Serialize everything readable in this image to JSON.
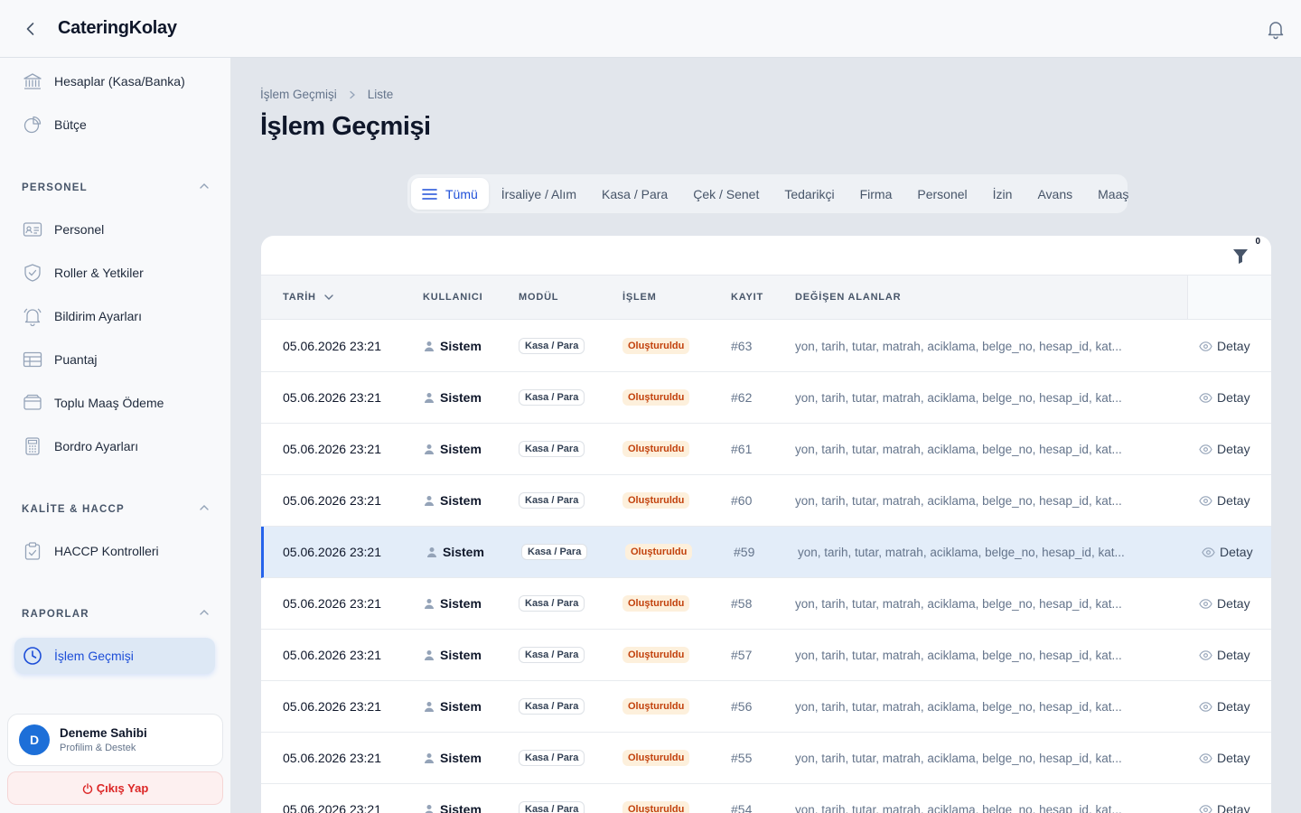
{
  "app": {
    "title": "CateringKolay"
  },
  "sidebar": {
    "top_items": [
      {
        "label": "Hesaplar (Kasa/Banka)",
        "icon": "bank-icon"
      },
      {
        "label": "Bütçe",
        "icon": "pie-chart-icon"
      }
    ],
    "sections": [
      {
        "title": "PERSONEL",
        "items": [
          "Personel",
          "Roller & Yetkiler",
          "Bildirim Ayarları",
          "Puantaj",
          "Toplu Maaş Ödeme",
          "Bordro Ayarları"
        ]
      },
      {
        "title": "KALİTE & HACCP",
        "items": [
          "HACCP Kontrolleri"
        ]
      },
      {
        "title": "RAPORLAR",
        "items": [
          "İşlem Geçmişi"
        ]
      }
    ],
    "active_item": "İşlem Geçmişi",
    "profile": {
      "initial": "D",
      "name": "Deneme Sahibi",
      "subtitle": "Profilim & Destek"
    },
    "logout_label": "Çıkış Yap"
  },
  "breadcrumb": [
    "İşlem Geçmişi",
    "Liste"
  ],
  "page_title": "İşlem Geçmişi",
  "tabs": [
    "Tümü",
    "İrsaliye / Alım",
    "Kasa / Para",
    "Çek / Senet",
    "Tedarikçi",
    "Firma",
    "Personel",
    "İzin",
    "Avans",
    "Maaş"
  ],
  "active_tab": "Tümü",
  "filter_count": "0",
  "table": {
    "headers": {
      "date": "TARİH",
      "user": "KULLANICI",
      "module": "MODÜL",
      "operation": "İŞLEM",
      "record": "KAYIT",
      "fields": "DEĞİŞEN ALANLAR"
    },
    "rows": [
      {
        "date": "05.06.2026 23:21",
        "user": "Sistem",
        "module": "Kasa / Para",
        "operation": "Oluşturuldu",
        "record": "#63",
        "fields": "yon, tarih, tutar, matrah, aciklama, belge_no, hesap_id, kat...",
        "action": "Detay"
      },
      {
        "date": "05.06.2026 23:21",
        "user": "Sistem",
        "module": "Kasa / Para",
        "operation": "Oluşturuldu",
        "record": "#62",
        "fields": "yon, tarih, tutar, matrah, aciklama, belge_no, hesap_id, kat...",
        "action": "Detay"
      },
      {
        "date": "05.06.2026 23:21",
        "user": "Sistem",
        "module": "Kasa / Para",
        "operation": "Oluşturuldu",
        "record": "#61",
        "fields": "yon, tarih, tutar, matrah, aciklama, belge_no, hesap_id, kat...",
        "action": "Detay"
      },
      {
        "date": "05.06.2026 23:21",
        "user": "Sistem",
        "module": "Kasa / Para",
        "operation": "Oluşturuldu",
        "record": "#60",
        "fields": "yon, tarih, tutar, matrah, aciklama, belge_no, hesap_id, kat...",
        "action": "Detay"
      },
      {
        "date": "05.06.2026 23:21",
        "user": "Sistem",
        "module": "Kasa / Para",
        "operation": "Oluşturuldu",
        "record": "#59",
        "fields": "yon, tarih, tutar, matrah, aciklama, belge_no, hesap_id, kat...",
        "action": "Detay"
      },
      {
        "date": "05.06.2026 23:21",
        "user": "Sistem",
        "module": "Kasa / Para",
        "operation": "Oluşturuldu",
        "record": "#58",
        "fields": "yon, tarih, tutar, matrah, aciklama, belge_no, hesap_id, kat...",
        "action": "Detay"
      },
      {
        "date": "05.06.2026 23:21",
        "user": "Sistem",
        "module": "Kasa / Para",
        "operation": "Oluşturuldu",
        "record": "#57",
        "fields": "yon, tarih, tutar, matrah, aciklama, belge_no, hesap_id, kat...",
        "action": "Detay"
      },
      {
        "date": "05.06.2026 23:21",
        "user": "Sistem",
        "module": "Kasa / Para",
        "operation": "Oluşturuldu",
        "record": "#56",
        "fields": "yon, tarih, tutar, matrah, aciklama, belge_no, hesap_id, kat...",
        "action": "Detay"
      },
      {
        "date": "05.06.2026 23:21",
        "user": "Sistem",
        "module": "Kasa / Para",
        "operation": "Oluşturuldu",
        "record": "#55",
        "fields": "yon, tarih, tutar, matrah, aciklama, belge_no, hesap_id, kat...",
        "action": "Detay"
      },
      {
        "date": "05.06.2026 23:21",
        "user": "Sistem",
        "module": "Kasa / Para",
        "operation": "Oluşturuldu",
        "record": "#54",
        "fields": "yon, tarih, tutar, matrah, aciklama, belge_no, hesap_id, kat...",
        "action": "Detay"
      }
    ],
    "selected_record": "#59"
  },
  "colors": {
    "accent": "#1d4ed8",
    "selected_row": "#e3edf9",
    "operation_badge": "#c2410c",
    "logout": "#dc2626"
  }
}
